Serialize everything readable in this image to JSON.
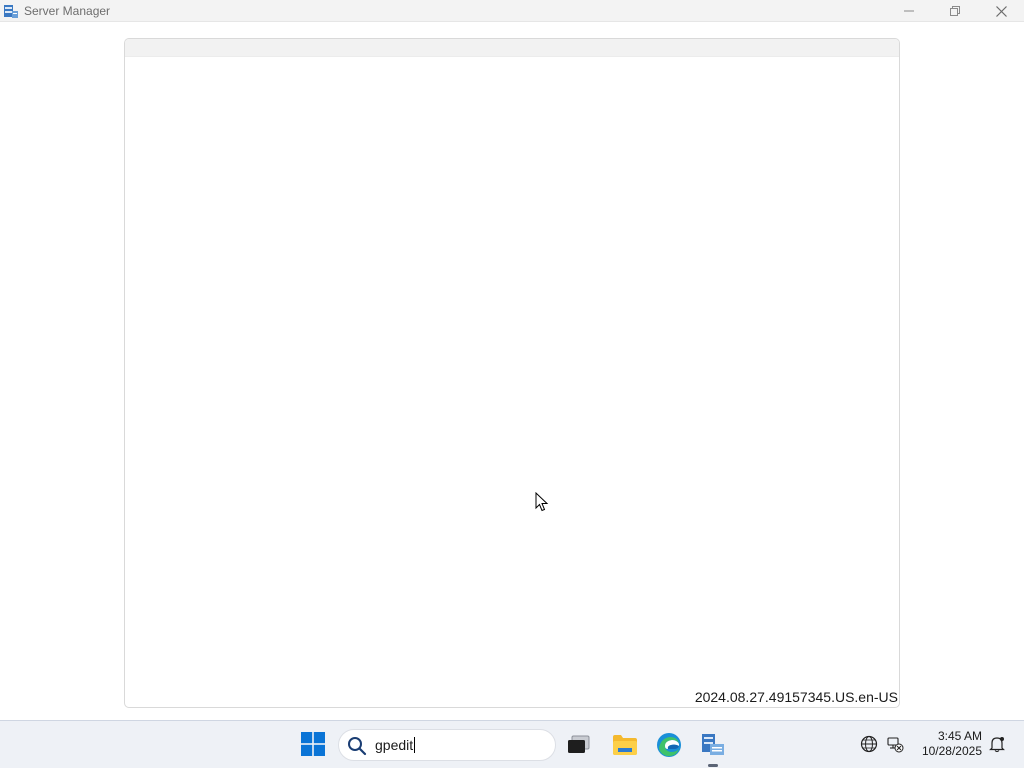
{
  "window": {
    "title": "Server Manager",
    "controls": {
      "minimize": "minimize-icon",
      "restore": "restore-icon",
      "close": "close-icon"
    }
  },
  "main": {
    "version": "2024.08.27.49157345.US.en-US"
  },
  "taskbar": {
    "search": {
      "value": "gpedit"
    },
    "apps": [
      "start-icon",
      "task-view-icon",
      "file-explorer-icon",
      "edge-icon",
      "server-manager-icon"
    ],
    "tray": {
      "icons": [
        "globe-icon",
        "network-disconnected-icon",
        "notification-icon"
      ],
      "time": "3:45 AM",
      "date": "10/28/2025"
    }
  },
  "colors": {
    "titlebar_bg": "#f3f3f3",
    "taskbar_bg": "#eef1f6",
    "start_blue": "#0a74d6"
  }
}
